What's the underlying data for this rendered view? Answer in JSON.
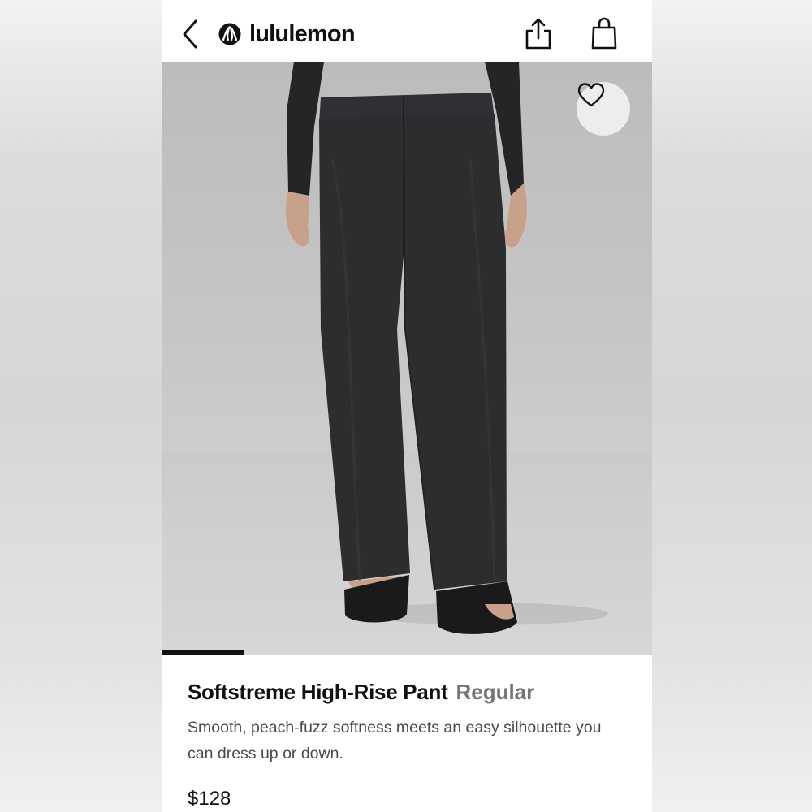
{
  "header": {
    "brand": "lululemon",
    "icons": [
      "back-icon",
      "lululemon-logo-icon",
      "share-icon",
      "shopping-bag-icon"
    ]
  },
  "hero": {
    "favorite_icon": "heart-outline-icon",
    "carousel_progress": 0.167
  },
  "product": {
    "name": "Softstreme High-Rise Pant",
    "variant": "Regular",
    "description": "Smooth, peach-fuzz softness meets an easy silhouette you can dress up or down.",
    "price": "$128"
  },
  "colors": {
    "text_primary": "#111111",
    "text_variant": "#757575",
    "text_secondary": "#4a4a4a",
    "pant_color": "#2c2d2f"
  }
}
